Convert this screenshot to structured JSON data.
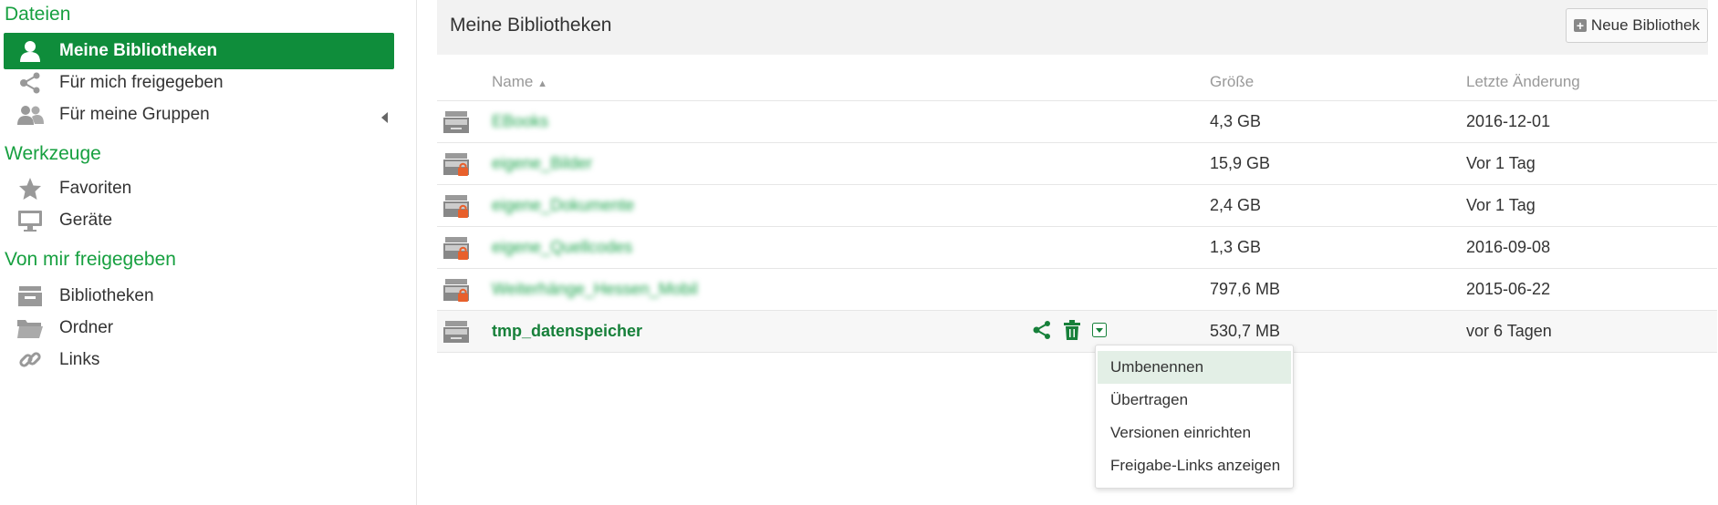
{
  "sidebar": {
    "section_files": "Dateien",
    "section_tools": "Werkzeuge",
    "section_shared": "Von mir freigegeben",
    "items": [
      {
        "label": "Meine Bibliotheken",
        "icon": "user-icon"
      },
      {
        "label": "Für mich freigegeben",
        "icon": "share-icon"
      },
      {
        "label": "Für meine Gruppen",
        "icon": "group-icon"
      },
      {
        "label": "Favoriten",
        "icon": "star-icon"
      },
      {
        "label": "Geräte",
        "icon": "monitor-icon"
      },
      {
        "label": "Bibliotheken",
        "icon": "library-icon"
      },
      {
        "label": "Ordner",
        "icon": "folder-icon"
      },
      {
        "label": "Links",
        "icon": "link-icon"
      }
    ]
  },
  "header": {
    "title": "Meine Bibliotheken",
    "new_library_label": "Neue Bibliothek"
  },
  "table": {
    "columns": {
      "name": "Name",
      "size": "Größe",
      "modified": "Letzte Änderung"
    },
    "sort_indicator": "▲",
    "rows": [
      {
        "name": "EBooks",
        "size": "4,3 GB",
        "modified": "2016-12-01",
        "encrypted": false
      },
      {
        "name": "eigene_Bilder",
        "size": "15,9 GB",
        "modified": "Vor 1 Tag",
        "encrypted": true
      },
      {
        "name": "eigene_Dokumente",
        "size": "2,4 GB",
        "modified": "Vor 1 Tag",
        "encrypted": true
      },
      {
        "name": "eigene_Quellcodes",
        "size": "1,3 GB",
        "modified": "2016-09-08",
        "encrypted": true
      },
      {
        "name": "Weiterhänge_Hessen_Mobil",
        "size": "797,6 MB",
        "modified": "2015-06-22",
        "encrypted": true
      },
      {
        "name": "tmp_datenspeicher",
        "size": "530,7 MB",
        "modified": "vor 6 Tagen",
        "encrypted": false
      }
    ]
  },
  "dropdown": {
    "items": [
      "Umbenennen",
      "Übertragen",
      "Versionen einrichten",
      "Freigabe-Links anzeigen"
    ]
  },
  "colors": {
    "accent": "#0f8d3b",
    "section_title": "#17a040",
    "lock": "#e8602c",
    "icon_grey": "#999999"
  }
}
